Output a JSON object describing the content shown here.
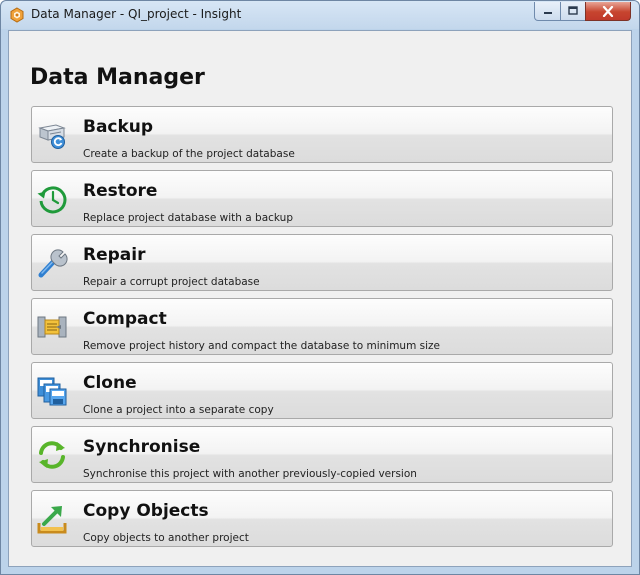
{
  "window": {
    "title": "Data Manager - QI_project - Insight"
  },
  "page": {
    "heading": "Data Manager"
  },
  "actions": [
    {
      "label": "Backup",
      "description": "Create a backup of the project database",
      "icon": "backup-icon"
    },
    {
      "label": "Restore",
      "description": "Replace project database with a backup",
      "icon": "restore-icon"
    },
    {
      "label": "Repair",
      "description": "Repair a corrupt project database",
      "icon": "wrench-icon"
    },
    {
      "label": "Compact",
      "description": "Remove project history and compact the database to minimum size",
      "icon": "compact-icon"
    },
    {
      "label": "Clone",
      "description": "Clone a project into a separate copy",
      "icon": "clone-icon"
    },
    {
      "label": "Synchronise",
      "description": "Synchronise this project with another previously-copied version",
      "icon": "sync-icon"
    },
    {
      "label": "Copy Objects",
      "description": "Copy objects to another project",
      "icon": "copy-objects-icon"
    }
  ],
  "colors": {
    "titlebar": "#c3d7ec",
    "client_background": "#f0f0f0",
    "button_border": "#a9a9a9",
    "close_button": "#c7452f",
    "restore_green": "#1f9a3a",
    "sync_green": "#58b52a"
  }
}
